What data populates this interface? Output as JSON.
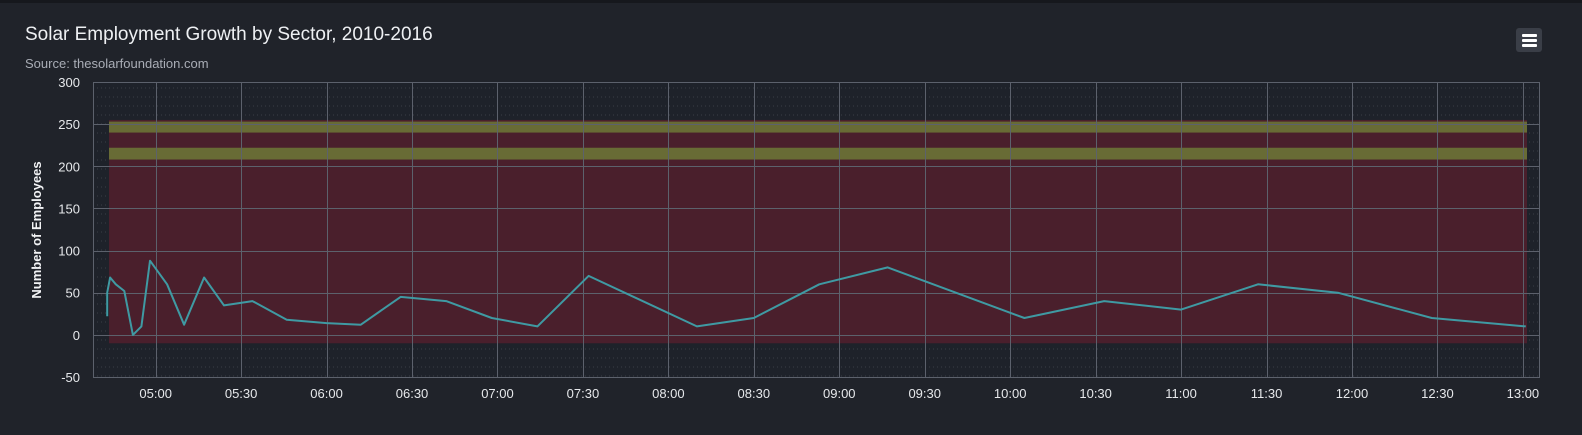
{
  "chart_data": {
    "type": "line",
    "title": "Solar Employment Growth by Sector, 2010-2016",
    "subtitle": "Source: thesolarfoundation.com",
    "ylabel": "Number of Employees",
    "xlabel": "",
    "ylim": [
      -50,
      300
    ],
    "yticks": [
      -50,
      0,
      50,
      100,
      150,
      200,
      250,
      300
    ],
    "xlim": [
      "04:38",
      "13:06"
    ],
    "xticks": [
      "05:00",
      "05:30",
      "06:00",
      "06:30",
      "07:00",
      "07:30",
      "08:00",
      "08:30",
      "09:00",
      "09:30",
      "10:00",
      "10:30",
      "11:00",
      "11:30",
      "12:00",
      "12:30",
      "13:00"
    ],
    "grid": true,
    "legend": "none",
    "plot_bands": [
      {
        "from": -10,
        "to": 255,
        "color": "#4a1f2c"
      },
      {
        "from": 240,
        "to": 253,
        "color": "#686b35"
      },
      {
        "from": 208,
        "to": 222,
        "color": "#686b35"
      }
    ],
    "series": [
      {
        "color": "#3f9aa3",
        "x": [
          "04:43",
          "04:43",
          "04:44",
          "04:46",
          "04:49",
          "04:52",
          "04:55",
          "04:58",
          "05:04",
          "05:10",
          "05:17",
          "05:24",
          "05:34",
          "05:46",
          "06:00",
          "06:12",
          "06:26",
          "06:42",
          "06:58",
          "07:14",
          "07:32",
          "08:10",
          "08:30",
          "08:53",
          "09:17",
          "10:05",
          "10:33",
          "11:00",
          "11:27",
          "11:55",
          "12:28",
          "13:01"
        ],
        "values": [
          22,
          50,
          68,
          60,
          52,
          0,
          10,
          88,
          60,
          12,
          68,
          35,
          40,
          18,
          14,
          12,
          45,
          40,
          20,
          10,
          70,
          10,
          20,
          60,
          80,
          20,
          40,
          30,
          60,
          50,
          20,
          10
        ]
      }
    ]
  },
  "ui": {
    "menu_icon": "hamburger-menu-icon"
  }
}
